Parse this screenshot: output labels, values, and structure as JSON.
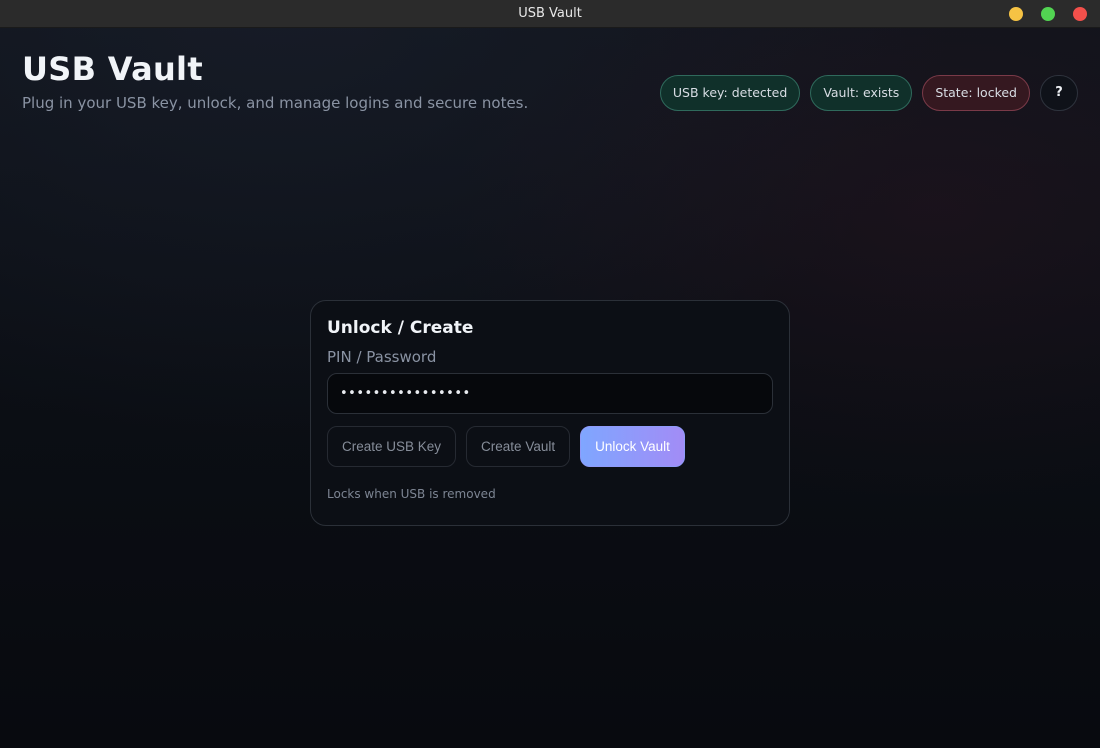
{
  "window": {
    "title": "USB Vault"
  },
  "header": {
    "title": "USB Vault",
    "subtitle": "Plug in your USB key, unlock, and manage logins and secure notes."
  },
  "status": {
    "usb_key": "USB key: detected",
    "vault": "Vault: exists",
    "state": "State: locked",
    "help_label": "?"
  },
  "unlock_card": {
    "title": "Unlock / Create",
    "field_label": "PIN / Password",
    "pin_value": "••••••••••••••••",
    "buttons": {
      "create_key": "Create USB Key",
      "create_vault": "Create Vault",
      "unlock": "Unlock Vault"
    },
    "note": "Locks when USB is removed"
  },
  "colors": {
    "ok_chip_bg": "#10302a",
    "bad_chip_bg": "#351820",
    "primary_gradient_start": "#7fa6ff",
    "primary_gradient_end": "#a28cf6",
    "window_close": "#f2504b",
    "window_minimize": "#f6c344",
    "window_maximize": "#52d452"
  },
  "icons": {
    "window_minimize": "minimize-dot-icon",
    "window_maximize": "maximize-dot-icon",
    "window_close": "close-dot-icon"
  }
}
